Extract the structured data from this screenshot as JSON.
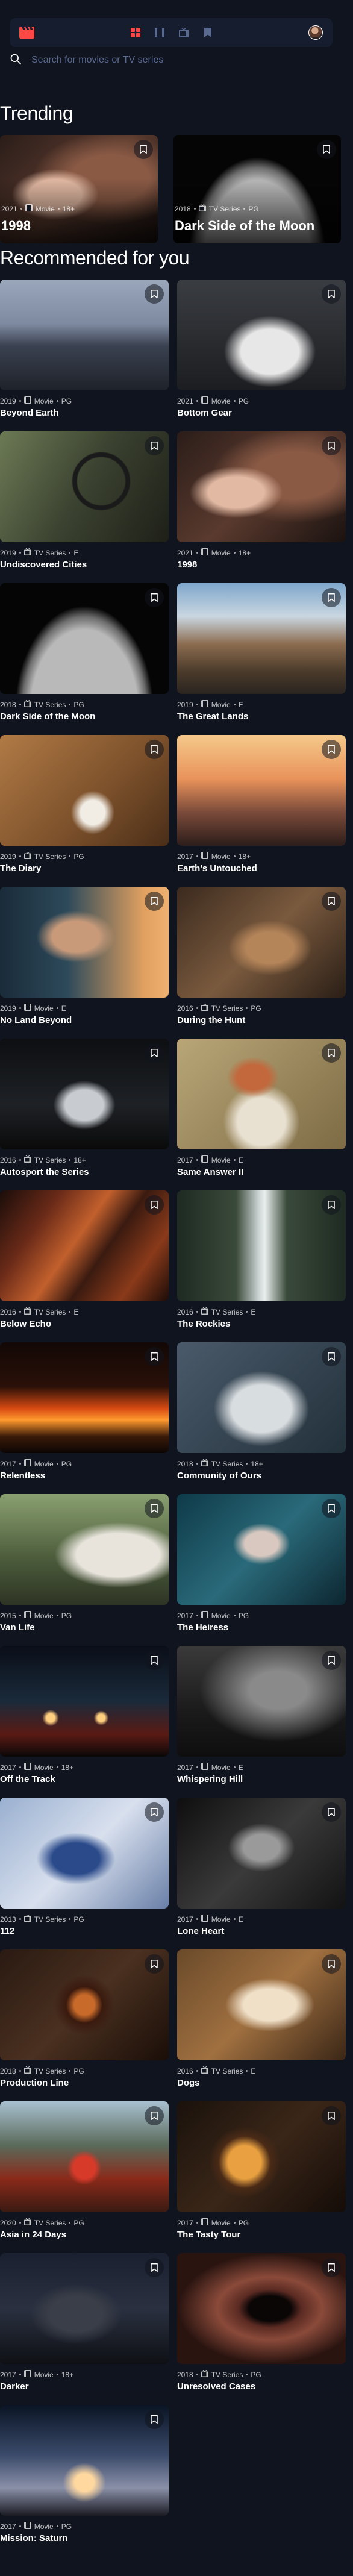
{
  "app": {
    "nav": [
      {
        "name": "nav-home-icon",
        "icon": "grid-icon",
        "active": true
      },
      {
        "name": "nav-movies-icon",
        "icon": "film-icon",
        "active": false
      },
      {
        "name": "nav-tv-icon",
        "icon": "tv-icon",
        "active": false
      },
      {
        "name": "nav-bookmarks-icon",
        "icon": "bookmark-icon",
        "active": false
      }
    ],
    "colors": {
      "accent": "#fc4747",
      "background": "#10141e",
      "surface": "#161d2f",
      "muted": "#5a698f"
    }
  },
  "search": {
    "placeholder": "Search for movies or TV series"
  },
  "trending": {
    "title": "Trending",
    "items": [
      {
        "year": "2021",
        "category": "Movie",
        "rating": "18+",
        "title": "1998",
        "image": "woman-hair"
      },
      {
        "year": "2018",
        "category": "TV Series",
        "rating": "PG",
        "title": "Dark Side of the Moon",
        "image": "moon"
      }
    ]
  },
  "recommended": {
    "title": "Recommended for you",
    "items": [
      {
        "year": "2019",
        "category": "Movie",
        "rating": "PG",
        "title": "Beyond Earth",
        "image": "rocks"
      },
      {
        "year": "2021",
        "category": "Movie",
        "rating": "PG",
        "title": "Bottom Gear",
        "image": "car-white"
      },
      {
        "year": "2019",
        "category": "TV Series",
        "rating": "E",
        "title": "Undiscovered Cities",
        "image": "steering"
      },
      {
        "year": "2021",
        "category": "Movie",
        "rating": "18+",
        "title": "1998",
        "image": "woman-hair"
      },
      {
        "year": "2018",
        "category": "TV Series",
        "rating": "PG",
        "title": "Dark Side of the Moon",
        "image": "moon"
      },
      {
        "year": "2019",
        "category": "Movie",
        "rating": "E",
        "title": "The Great Lands",
        "image": "mountains"
      },
      {
        "year": "2019",
        "category": "TV Series",
        "rating": "PG",
        "title": "The Diary",
        "image": "desk"
      },
      {
        "year": "2017",
        "category": "Movie",
        "rating": "18+",
        "title": "Earth's Untouched",
        "image": "sunset-people"
      },
      {
        "year": "2019",
        "category": "Movie",
        "rating": "E",
        "title": "No Land Beyond",
        "image": "portrait"
      },
      {
        "year": "2016",
        "category": "TV Series",
        "rating": "PG",
        "title": "During the Hunt",
        "image": "deer"
      },
      {
        "year": "2016",
        "category": "TV Series",
        "rating": "18+",
        "title": "Autosport the Series",
        "image": "car-dark"
      },
      {
        "year": "2017",
        "category": "Movie",
        "rating": "E",
        "title": "Same Answer II",
        "image": "redhead"
      },
      {
        "year": "2016",
        "category": "TV Series",
        "rating": "E",
        "title": "Below Echo",
        "image": "canyon"
      },
      {
        "year": "2016",
        "category": "TV Series",
        "rating": "E",
        "title": "The Rockies",
        "image": "waterfall"
      },
      {
        "year": "2017",
        "category": "Movie",
        "rating": "PG",
        "title": "Relentless",
        "image": "fire"
      },
      {
        "year": "2018",
        "category": "TV Series",
        "rating": "18+",
        "title": "Community of Ours",
        "image": "table"
      },
      {
        "year": "2015",
        "category": "Movie",
        "rating": "PG",
        "title": "Van Life",
        "image": "van"
      },
      {
        "year": "2017",
        "category": "Movie",
        "rating": "PG",
        "title": "The Heiress",
        "image": "queen"
      },
      {
        "year": "2017",
        "category": "Movie",
        "rating": "18+",
        "title": "Off the Track",
        "image": "night-cars"
      },
      {
        "year": "2017",
        "category": "Movie",
        "rating": "E",
        "title": "Whispering Hill",
        "image": "fog"
      },
      {
        "year": "2013",
        "category": "TV Series",
        "rating": "PG",
        "title": "112",
        "image": "medical"
      },
      {
        "year": "2017",
        "category": "Movie",
        "rating": "E",
        "title": "Lone Heart",
        "image": "mono-face"
      },
      {
        "year": "2018",
        "category": "TV Series",
        "rating": "PG",
        "title": "Production Line",
        "image": "eye"
      },
      {
        "year": "2016",
        "category": "TV Series",
        "rating": "E",
        "title": "Dogs",
        "image": "dog"
      },
      {
        "year": "2020",
        "category": "TV Series",
        "rating": "PG",
        "title": "Asia in 24 Days",
        "image": "temple"
      },
      {
        "year": "2017",
        "category": "Movie",
        "rating": "PG",
        "title": "The Tasty Tour",
        "image": "food"
      },
      {
        "year": "2017",
        "category": "Movie",
        "rating": "18+",
        "title": "Darker",
        "image": "dragon"
      },
      {
        "year": "2018",
        "category": "TV Series",
        "rating": "PG",
        "title": "Unresolved Cases",
        "image": "hole"
      },
      {
        "year": "2017",
        "category": "Movie",
        "rating": "PG",
        "title": "Mission: Saturn",
        "image": "launch"
      }
    ]
  }
}
